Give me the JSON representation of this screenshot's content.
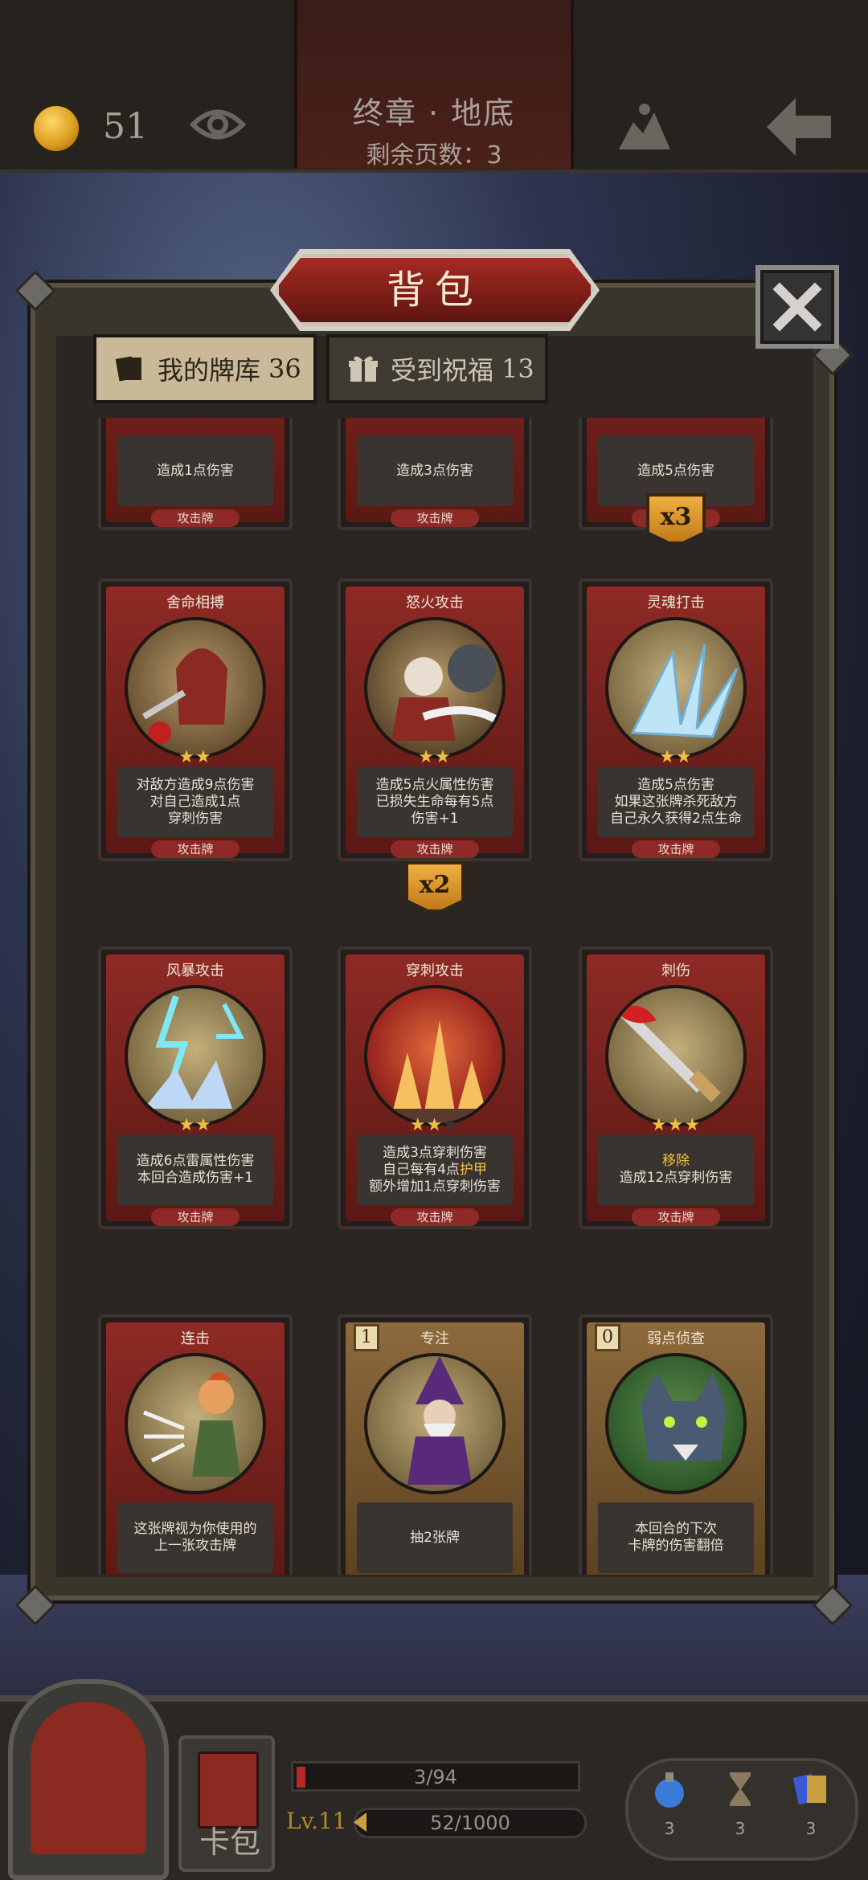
{
  "topbar": {
    "coins": "51",
    "chapter_title": "终章 · 地底",
    "pages_remaining": "剩余页数：3"
  },
  "panel": {
    "title": "背包",
    "tabs": [
      {
        "label": "我的牌库",
        "count": "36",
        "active": true
      },
      {
        "label": "受到祝福",
        "count": "13",
        "active": false
      }
    ]
  },
  "cards_partial": [
    {
      "desc": "造成1点伤害",
      "type": "攻击牌"
    },
    {
      "desc": "造成3点伤害",
      "type": "攻击牌"
    },
    {
      "desc": "造成5点伤害",
      "type": "攻击牌",
      "multiplier": "x3"
    }
  ],
  "cards": [
    {
      "name": "舍命相搏",
      "stars": 2,
      "max_stars": 2,
      "desc": [
        "对敌方造成9点伤害",
        "对自己造成1点",
        "穿刺伤害"
      ],
      "type": "攻击牌"
    },
    {
      "name": "怒火攻击",
      "stars": 2,
      "max_stars": 2,
      "desc": [
        "造成5点火属性伤害",
        "已损失生命每有5点",
        "伤害+1"
      ],
      "type": "攻击牌",
      "multiplier": "x2"
    },
    {
      "name": "灵魂打击",
      "stars": 2,
      "max_stars": 2,
      "desc": [
        "造成5点伤害",
        "如果这张牌杀死敌方",
        "自己永久获得2点生命"
      ],
      "type": "攻击牌"
    },
    {
      "name": "风暴攻击",
      "stars": 2,
      "max_stars": 2,
      "desc": [
        "造成6点雷属性伤害",
        "本回合造成伤害+1"
      ],
      "type": "攻击牌"
    },
    {
      "name": "穿刺攻击",
      "stars": 2,
      "max_stars": 3,
      "desc_pre": [
        "造成3点穿刺伤害"
      ],
      "desc_mixed": {
        "before": "自己每有4点",
        "highlight": "护甲"
      },
      "desc_post": [
        "额外增加1点穿刺伤害"
      ],
      "type": "攻击牌"
    },
    {
      "name": "刺伤",
      "stars": 3,
      "max_stars": 3,
      "desc_highlight": "移除",
      "desc": [
        "造成12点穿刺伤害"
      ],
      "type": "攻击牌"
    },
    {
      "name": "连击",
      "desc": [
        "这张牌视为你使用的",
        "上一张攻击牌"
      ]
    },
    {
      "name": "专注",
      "cost": "1",
      "desc": [
        "抽2张牌"
      ]
    },
    {
      "name": "弱点侦查",
      "cost": "0",
      "desc": [
        "本回合的下次",
        "卡牌的伤害翻倍"
      ]
    }
  ],
  "hud": {
    "deck_label": "卡包",
    "hp_text": "3/94",
    "hp_fraction": 0.032,
    "level": "Lv.11",
    "xp_text": "52/1000",
    "items": [
      {
        "icon": "potion-icon",
        "count": "3"
      },
      {
        "icon": "hourglass-icon",
        "count": "3"
      },
      {
        "icon": "cards-icon",
        "count": "3"
      }
    ]
  }
}
